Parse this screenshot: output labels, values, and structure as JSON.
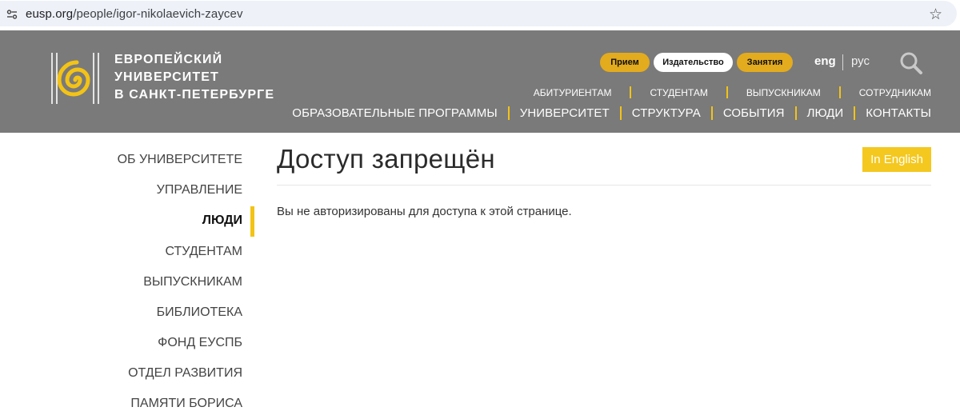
{
  "browser": {
    "url_host": "eusp.org",
    "url_path": "/people/igor-nikolaevich-zaycev"
  },
  "header": {
    "logo_lines": [
      "Европейский",
      "университет",
      "в Санкт-Петербурге"
    ],
    "pills": [
      "Прием",
      "Издательство",
      "Занятия"
    ],
    "lang_eng": "eng",
    "lang_rus": "рус",
    "subnav": [
      "АБИТУРИЕНТАМ",
      "СТУДЕНТАМ",
      "ВЫПУСКНИКАМ",
      "СОТРУДНИКАМ"
    ],
    "mainnav": [
      "ОБРАЗОВАТЕЛЬНЫЕ ПРОГРАММЫ",
      "УНИВЕРСИТЕТ",
      "СТРУКТУРА",
      "СОБЫТИЯ",
      "ЛЮДИ",
      "КОНТАКТЫ"
    ],
    "accent_color": "#f3c316",
    "header_color": "#7a7a7a"
  },
  "sidebar": {
    "items": [
      {
        "label": "Об университете"
      },
      {
        "label": "Управление"
      },
      {
        "label": "Люди"
      },
      {
        "label": "Студентам"
      },
      {
        "label": "Выпускникам"
      },
      {
        "label": "Библиотека"
      },
      {
        "label": "Фонд ЕУСПб"
      },
      {
        "label": "Отдел развития"
      },
      {
        "label": "Памяти Бориса"
      }
    ],
    "active_index": 2
  },
  "content": {
    "title": "Доступ запрещён",
    "english_button": "In English",
    "message": "Вы не авторизированы для доступа к этой странице."
  }
}
